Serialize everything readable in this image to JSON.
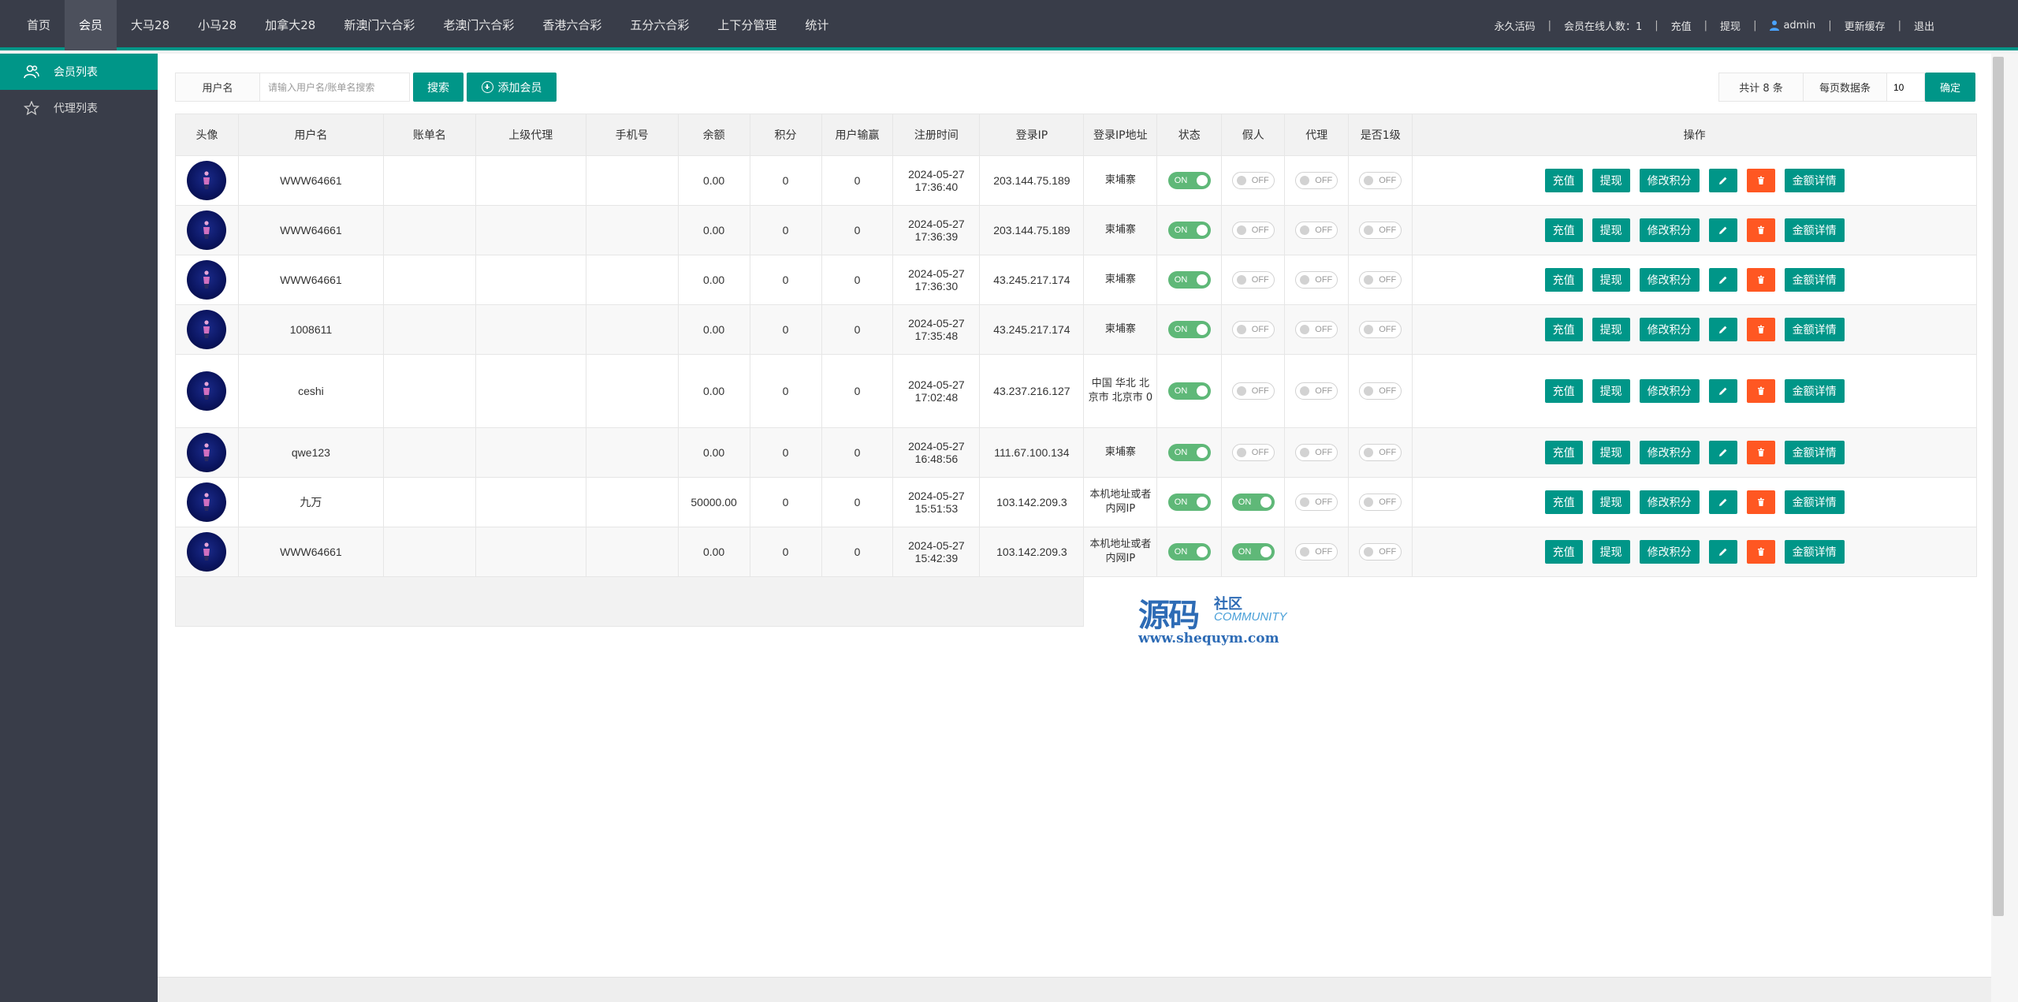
{
  "top_nav": [
    {
      "label": "首页",
      "active": false
    },
    {
      "label": "会员",
      "active": true
    },
    {
      "label": "大马28",
      "active": false
    },
    {
      "label": "小马28",
      "active": false
    },
    {
      "label": "加拿大28",
      "active": false
    },
    {
      "label": "新澳门六合彩",
      "active": false
    },
    {
      "label": "老澳门六合彩",
      "active": false
    },
    {
      "label": "香港六合彩",
      "active": false
    },
    {
      "label": "五分六合彩",
      "active": false
    },
    {
      "label": "上下分管理",
      "active": false
    },
    {
      "label": "统计",
      "active": false
    }
  ],
  "top_right": {
    "activation": "永久活码",
    "online": "会员在线人数：1",
    "recharge": "充值",
    "withdraw": "提现",
    "username": "admin",
    "clear_cache": "更新缓存",
    "logout": "退出",
    "separator": "|"
  },
  "sidebar": {
    "items": [
      {
        "label": "会员列表",
        "icon": "users-icon",
        "active": true
      },
      {
        "label": "代理列表",
        "icon": "star-icon",
        "active": false
      }
    ]
  },
  "toolbar": {
    "field_label": "用户名",
    "search_placeholder": "请输入用户名/账单名搜索",
    "search_button": "搜索",
    "add_button": "添加会员"
  },
  "pager": {
    "total": "共计 8 条",
    "per_page_label": "每页数据条",
    "per_page_value": "10",
    "confirm": "确定"
  },
  "table": {
    "headers": [
      "头像",
      "用户名",
      "账单名",
      "上级代理",
      "手机号",
      "余额",
      "积分",
      "用户输赢",
      "注册时间",
      "登录IP",
      "登录IP地址",
      "状态",
      "假人",
      "代理",
      "是否1级",
      "操作"
    ],
    "ops_labels": {
      "recharge": "充值",
      "withdraw": "提现",
      "points": "修改积分",
      "details": "金额详情"
    },
    "toggle_labels": {
      "on": "ON",
      "off": "OFF"
    },
    "rows": [
      {
        "username": "WWW64661",
        "billname": "",
        "parent": "",
        "phone": "",
        "balance": "0.00",
        "points": "0",
        "winloss": "0",
        "reg_date": "2024-05-27",
        "reg_time": "17:36:40",
        "ip": "203.144.75.189",
        "ip_addr": "柬埔寨",
        "status": true,
        "fake": false,
        "agent": false,
        "level1": false
      },
      {
        "username": "WWW64661",
        "billname": "",
        "parent": "",
        "phone": "",
        "balance": "0.00",
        "points": "0",
        "winloss": "0",
        "reg_date": "2024-05-27",
        "reg_time": "17:36:39",
        "ip": "203.144.75.189",
        "ip_addr": "柬埔寨",
        "status": true,
        "fake": false,
        "agent": false,
        "level1": false
      },
      {
        "username": "WWW64661",
        "billname": "",
        "parent": "",
        "phone": "",
        "balance": "0.00",
        "points": "0",
        "winloss": "0",
        "reg_date": "2024-05-27",
        "reg_time": "17:36:30",
        "ip": "43.245.217.174",
        "ip_addr": "柬埔寨",
        "status": true,
        "fake": false,
        "agent": false,
        "level1": false
      },
      {
        "username": "1008611",
        "billname": "",
        "parent": "",
        "phone": "",
        "balance": "0.00",
        "points": "0",
        "winloss": "0",
        "reg_date": "2024-05-27",
        "reg_time": "17:35:48",
        "ip": "43.245.217.174",
        "ip_addr": "柬埔寨",
        "status": true,
        "fake": false,
        "agent": false,
        "level1": false
      },
      {
        "username": "ceshi",
        "billname": "",
        "parent": "",
        "phone": "",
        "balance": "0.00",
        "points": "0",
        "winloss": "0",
        "reg_date": "2024-05-27",
        "reg_time": "17:02:48",
        "ip": "43.237.216.127",
        "ip_addr": "中国 华北 北京市 北京市 0",
        "status": true,
        "fake": false,
        "agent": false,
        "level1": false
      },
      {
        "username": "qwe123",
        "billname": "",
        "parent": "",
        "phone": "",
        "balance": "0.00",
        "points": "0",
        "winloss": "0",
        "reg_date": "2024-05-27",
        "reg_time": "16:48:56",
        "ip": "111.67.100.134",
        "ip_addr": "柬埔寨",
        "status": true,
        "fake": false,
        "agent": false,
        "level1": false
      },
      {
        "username": "九万",
        "billname": "",
        "parent": "",
        "phone": "",
        "balance": "50000.00",
        "points": "0",
        "winloss": "0",
        "reg_date": "2024-05-27",
        "reg_time": "15:51:53",
        "ip": "103.142.209.3",
        "ip_addr": "本机地址或者内网IP",
        "status": true,
        "fake": true,
        "agent": false,
        "level1": false
      },
      {
        "username": "WWW64661",
        "billname": "",
        "parent": "",
        "phone": "",
        "balance": "0.00",
        "points": "0",
        "winloss": "0",
        "reg_date": "2024-05-27",
        "reg_time": "15:42:39",
        "ip": "103.142.209.3",
        "ip_addr": "本机地址或者内网IP",
        "status": true,
        "fake": true,
        "agent": false,
        "level1": false
      }
    ]
  },
  "watermark": {
    "main": "源码",
    "sub": "社区",
    "community": "COMMUNITY",
    "url": "www.shequym.com"
  },
  "colors": {
    "header_bg": "#393d49",
    "accent": "#009688",
    "danger": "#ff5722",
    "toggle_on": "#5fb878"
  }
}
